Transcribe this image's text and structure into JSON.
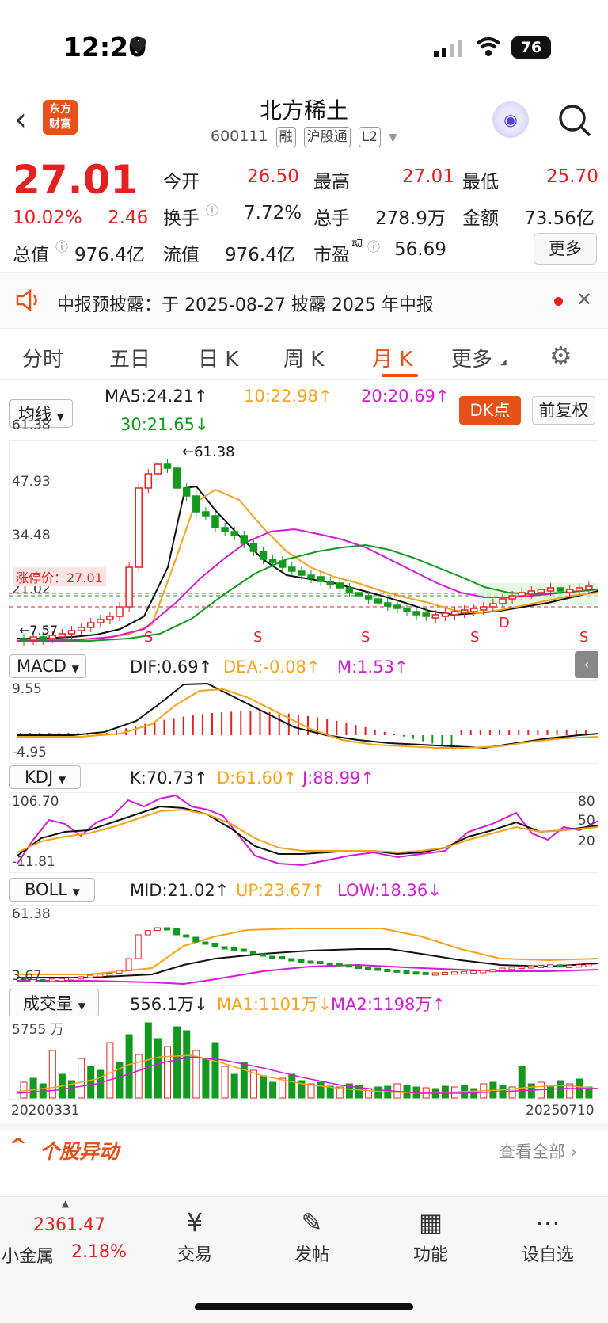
{
  "status": {
    "time": "12:20",
    "battery": "76"
  },
  "header": {
    "logo": "东方\n财富",
    "title": "北方稀土",
    "code": "600111",
    "tags": [
      "融",
      "沪股通",
      "L2"
    ]
  },
  "quote": {
    "price": "27.01",
    "pct": "10.02%",
    "chg": "2.46",
    "open_l": "今开",
    "open": "26.50",
    "high_l": "最高",
    "high": "27.01",
    "low_l": "最低",
    "low": "25.70",
    "turn_l": "换手",
    "turn": "7.72%",
    "vol_l": "总手",
    "vol": "278.9万",
    "amt_l": "金额",
    "amt": "73.56亿",
    "mcap_l": "总值",
    "mcap": "976.4亿",
    "float_l": "流值",
    "float": "976.4亿",
    "pe_l": "市盈",
    "pe_sup": "动",
    "pe": "56.69",
    "more": "更多"
  },
  "notice": {
    "text": "中报预披露：于 2025-08-27 披露 2025 年中报"
  },
  "tabs": [
    "分时",
    "五日",
    "日 K",
    "周 K",
    "月 K",
    "更多"
  ],
  "ma": {
    "sel": "均线",
    "ma5": "MA5:24.21↑",
    "ma10": "10:22.98↑",
    "ma20": "20:20.69↑",
    "ma30": "30:21.65↓",
    "dk": "DK点",
    "fq": "前复权"
  },
  "kchart": {
    "y1": "61.38",
    "y2": "47.93",
    "y3": "34.48",
    "y4": "21.02",
    "peak": "←61.38",
    "low": "←7.57",
    "limit": "涨停价：27.01",
    "marks": [
      "S",
      "S",
      "S",
      "S",
      "S",
      "S",
      "D"
    ]
  },
  "macd": {
    "sel": "MACD",
    "dif": "DIF:0.69↑",
    "dea": "DEA:-0.08↑",
    "m": "M:1.53↑",
    "top": "9.55",
    "bot": "-4.95"
  },
  "kdj": {
    "sel": "KDJ",
    "k": "K:70.73↑",
    "d": "D:61.60↑",
    "j": "J:88.99↑",
    "top": "106.70",
    "bot": "-11.81",
    "r80": "80",
    "r50": "50",
    "r20": "20"
  },
  "boll": {
    "sel": "BOLL",
    "mid": "MID:21.02↑",
    "up": "UP:23.67↑",
    "low": "LOW:18.36↓",
    "top": "61.38",
    "bot": "3.67"
  },
  "volume": {
    "sel": "成交量",
    "v": "556.1万↓",
    "ma1": "MA1:1101万↓",
    "ma2": "MA2:1198万↑",
    "top": "5755 万",
    "start": "20200331",
    "end": "20250710"
  },
  "section": {
    "title": "个股异动",
    "more": "查看全部"
  },
  "nav": {
    "index_val": "2361.47",
    "index_name": "小金属",
    "index_pct": "2.18%",
    "items": [
      "交易",
      "发帖",
      "功能",
      "设自选"
    ]
  }
}
